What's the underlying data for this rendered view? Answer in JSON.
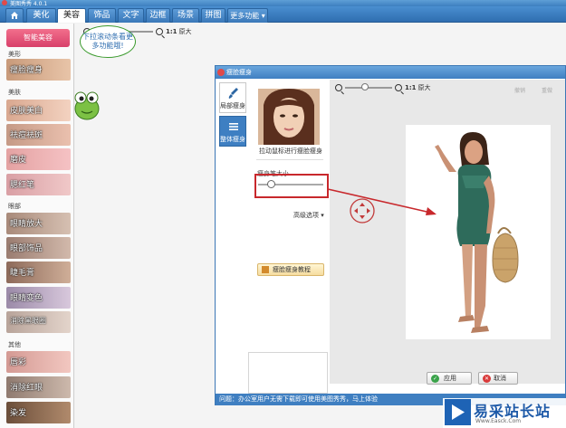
{
  "app": {
    "title": "美图秀秀 4.0.1"
  },
  "menu": {
    "tabs": [
      {
        "label": "美化"
      },
      {
        "label": "美容"
      },
      {
        "label": "饰品"
      },
      {
        "label": "文字"
      },
      {
        "label": "边框"
      },
      {
        "label": "场景"
      },
      {
        "label": "拼图"
      },
      {
        "label": "更多功能 ▾"
      }
    ],
    "active_tab": "美容"
  },
  "left_panel": {
    "smart_button": "智能美容",
    "sections": [
      {
        "title": "美形",
        "items": [
          "瘦脸瘦身"
        ]
      },
      {
        "title": "美肤",
        "items": [
          "皮肤美白",
          "祛痘祛斑",
          "磨皮",
          "腮红笔"
        ]
      },
      {
        "title": "眼部",
        "items": [
          "眼睛放大",
          "眼部饰品",
          "睫毛膏",
          "眼睛变色",
          "消除黑眼圈"
        ]
      },
      {
        "title": "其他",
        "items": [
          "唇彩",
          "消除红眼",
          "染发"
        ]
      }
    ]
  },
  "workspace": {
    "zoom_ratio": "1:1",
    "zoom_original": "原大",
    "bubble_text": "下拉滚动条看更多功能哦!"
  },
  "dialog": {
    "title": "瘦脸瘦身",
    "tabs": [
      "局部瘦身",
      "整体瘦身"
    ],
    "hint": "拉动鼠标进行瘦脸瘦身",
    "pen_size_label": "瘦身笔大小",
    "advanced": "高级选项 ▾",
    "tutorial": "瘦脸瘦身教程",
    "zoom_ratio": "1:1",
    "zoom_original": "原大",
    "undo": "撤销",
    "redo": "重做",
    "ok": "应用",
    "cancel": "取消",
    "status": "问题：办公室用户无需下载即可使用美图秀秀，马上体验"
  },
  "watermark": {
    "brand": "易采站长站",
    "url": "Www.Easck.Com"
  },
  "colors": {
    "menubar": "#3a7cc0",
    "smart_button": "#e05078",
    "highlight": "#c8282c",
    "swimsuit": "#2e6b5b"
  }
}
